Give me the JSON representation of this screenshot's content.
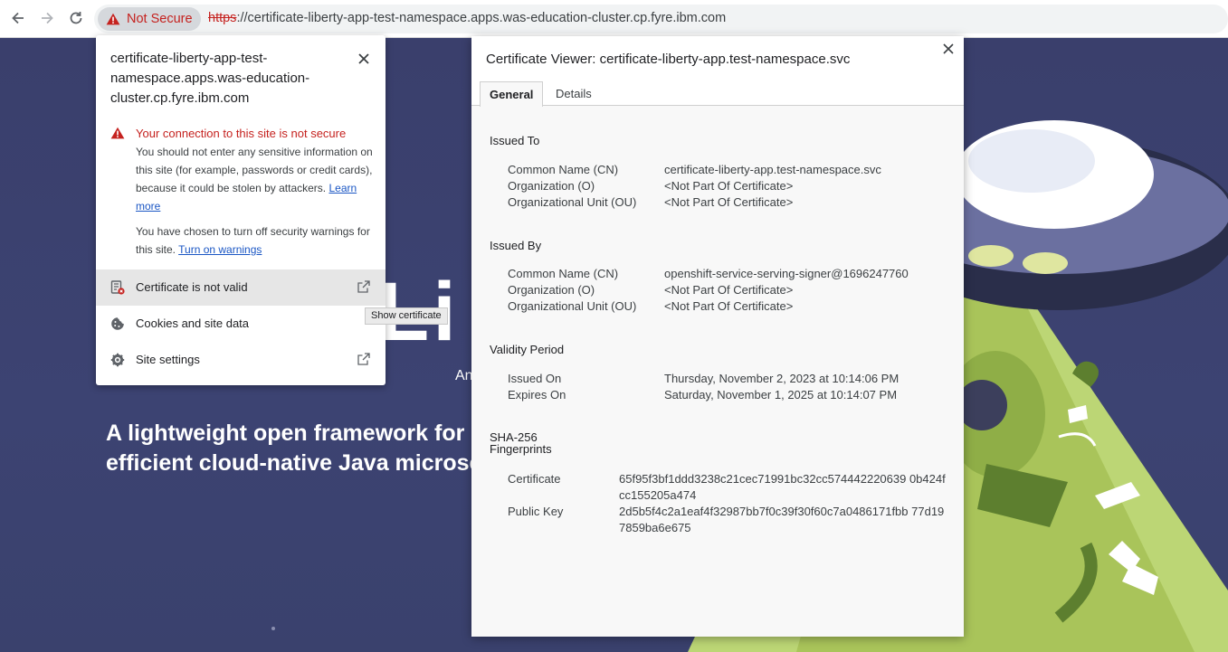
{
  "toolbar": {
    "security_chip": "Not Secure",
    "url_scheme": "https",
    "url_rest": "://certificate-liberty-app-test-namespace.apps.was-education-cluster.cp.fyre.ibm.com"
  },
  "page": {
    "logo_fragment": "Li",
    "subtitle_fragment": "An",
    "hero_line1": "A lightweight open framework for buil",
    "hero_line2": "efficient cloud-native Java microservic"
  },
  "site_popup": {
    "host": "certificate-liberty-app-test-namespace.apps.was-education-cluster.cp.fyre.ibm.com",
    "warning_title": "Your connection to this site is not secure",
    "warning_body": "You should not enter any sensitive information on this site (for example, passwords or credit cards), because it could be stolen by attackers.",
    "learn_more": "Learn more",
    "warnings_body": "You have chosen to turn off security warnings for this site.",
    "turn_on_warnings": "Turn on warnings",
    "items": [
      {
        "label": "Certificate is not valid"
      },
      {
        "label": "Cookies and site data"
      },
      {
        "label": "Site settings"
      }
    ]
  },
  "tooltip": "Show certificate",
  "cert_viewer": {
    "title": "Certificate Viewer: certificate-liberty-app.test-namespace.svc",
    "tabs": [
      "General",
      "Details"
    ],
    "issued_to": {
      "heading": "Issued To",
      "rows": [
        {
          "label": "Common Name (CN)",
          "value": "certificate-liberty-app.test-namespace.svc"
        },
        {
          "label": "Organization (O)",
          "value": "<Not Part Of Certificate>"
        },
        {
          "label": "Organizational Unit (OU)",
          "value": "<Not Part Of Certificate>"
        }
      ]
    },
    "issued_by": {
      "heading": "Issued By",
      "rows": [
        {
          "label": "Common Name (CN)",
          "value": "openshift-service-serving-signer@1696247760"
        },
        {
          "label": "Organization (O)",
          "value": "<Not Part Of Certificate>"
        },
        {
          "label": "Organizational Unit (OU)",
          "value": "<Not Part Of Certificate>"
        }
      ]
    },
    "validity": {
      "heading": "Validity Period",
      "rows": [
        {
          "label": "Issued On",
          "value": "Thursday, November 2, 2023 at 10:14:06 PM"
        },
        {
          "label": "Expires On",
          "value": "Saturday, November 1, 2025 at 10:14:07 PM"
        }
      ]
    },
    "fingerprints": {
      "heading_line1": "SHA-256",
      "heading_line2": "Fingerprints",
      "rows": [
        {
          "label": "Certificate",
          "value": "65f95f3bf1ddd3238c21cec71991bc32cc574442220639 0b424fcc155205a474"
        },
        {
          "label": "Public Key",
          "value": "2d5b5f4c2a1eaf4f32987bb7f0c39f30f60c7a0486171fbb 77d197859ba6e675"
        }
      ]
    }
  },
  "colors": {
    "danger": "#c5221f",
    "link": "#1a56c4",
    "page_bg": "#3b4170",
    "illustration_green": "#a9c45a"
  }
}
